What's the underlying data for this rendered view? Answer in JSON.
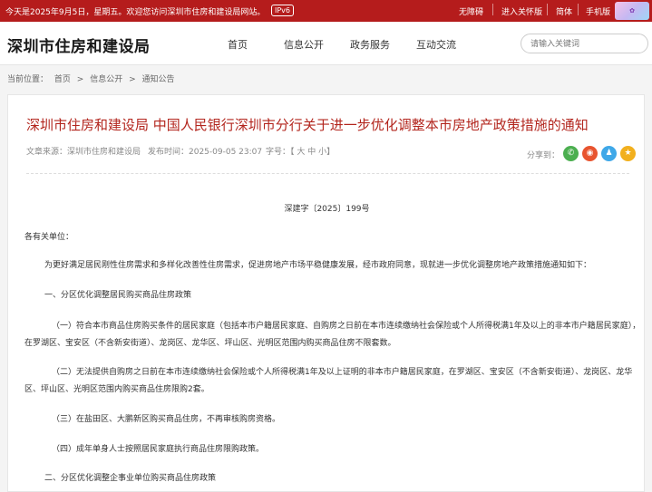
{
  "topbar": {
    "welcome": "今天是2025年9月5日，星期五。欢迎您访问深圳市住房和建设局网站。",
    "ipv6": "IPv6",
    "links": [
      "无障碍",
      "进入关怀版",
      "简体",
      "手机版"
    ]
  },
  "header": {
    "logo": "深圳市住房和建设局",
    "nav": [
      "首页",
      "信息公开",
      "政务服务",
      "互动交流"
    ],
    "search_placeholder": "请输入关键词"
  },
  "breadcrumb": {
    "prefix": "当前位置：",
    "items": [
      "首页",
      "信息公开",
      "通知公告"
    ],
    "separator": ">"
  },
  "article": {
    "title": "深圳市住房和建设局 中国人民银行深圳市分行关于进一步优化调整本市房地产政策措施的通知",
    "source": "文章来源：深圳市住房和建设局",
    "time": "发布时间：2025-09-05 23:07",
    "fontsize": "字号：【 大  中  小】",
    "share_label": "分享到：",
    "doc_no": "深建字〔2025〕199号",
    "paragraphs": [
      "各有关单位：",
      "为更好满足居民刚性住房需求和多样化改善性住房需求，促进房地产市场平稳健康发展，经市政府同意，现就进一步优化调整房地产政策措施通知如下：",
      "一、分区优化调整居民购买商品住房政策",
      "（一）符合本市商品住房购买条件的居民家庭（包括本市户籍居民家庭、自购房之日前在本市连续缴纳社会保险或个人所得税满1年及以上的非本市户籍居民家庭），在罗湖区、宝安区（不含新安街道）、龙岗区、龙华区、坪山区、光明区范围内购买商品住房不限套数。",
      "（二）无法提供自购房之日前在本市连续缴纳社会保险或个人所得税满1年及以上证明的非本市户籍居民家庭，在罗湖区、宝安区（不含新安街道）、龙岗区、龙华区、坪山区、光明区范围内购买商品住房限购2套。",
      "（三）在盐田区、大鹏新区购买商品住房，不再审核购房资格。",
      "（四）成年单身人士按照居民家庭执行商品住房限购政策。",
      "二、分区优化调整企事业单位购买商品住房政策"
    ]
  },
  "colors": {
    "brand_red": "#b51c1c",
    "title_red": "#b3261e",
    "wechat": "#4caf50",
    "weibo": "#e8542f",
    "qq": "#3fa8e8",
    "qzone": "#f2b01e"
  },
  "icons": [
    "wechat-icon",
    "weibo-icon",
    "qq-icon",
    "qzone-icon"
  ]
}
